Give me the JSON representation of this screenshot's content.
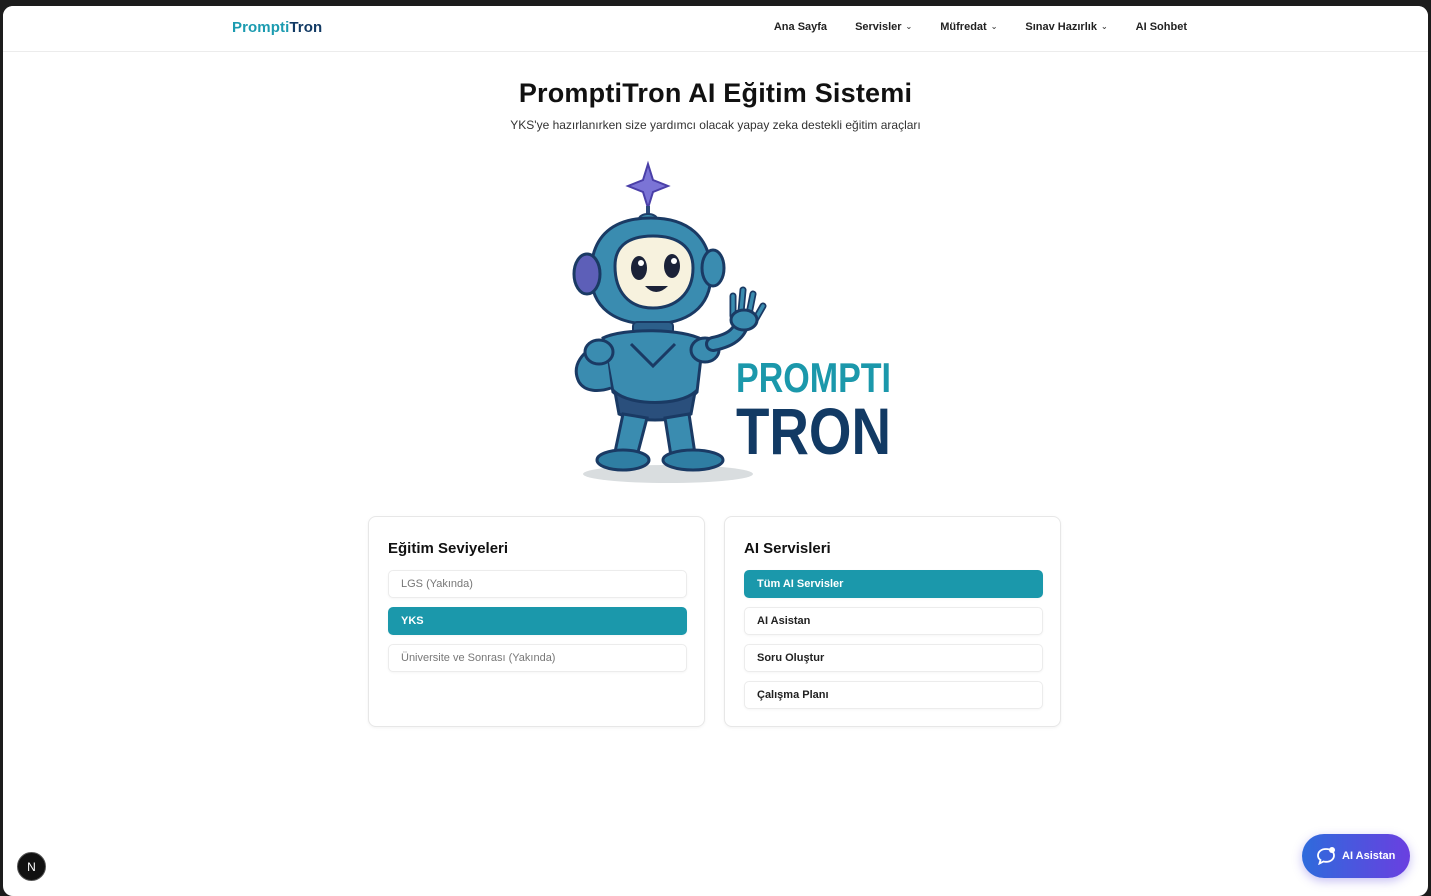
{
  "header": {
    "brand_part1": "Prompti",
    "brand_part2": "Tron",
    "nav": [
      {
        "label": "Ana Sayfa",
        "dropdown": false
      },
      {
        "label": "Servisler",
        "dropdown": true
      },
      {
        "label": "Müfredat",
        "dropdown": true
      },
      {
        "label": "Sınav Hazırlık",
        "dropdown": true
      },
      {
        "label": "AI Sohbet",
        "dropdown": false
      }
    ]
  },
  "hero": {
    "title": "PromptiTron AI Eğitim Sistemi",
    "subtitle": "YKS'ye hazırlanırken size yardımcı olacak yapay zeka destekli eğitim araçları",
    "logo_line1": "PROMPTI",
    "logo_line2": "TRON"
  },
  "levels": {
    "title": "Eğitim Seviyeleri",
    "items": [
      {
        "label": "LGS (Yakında)",
        "state": "disabled"
      },
      {
        "label": "YKS",
        "state": "active"
      },
      {
        "label": "Üniversite ve Sonrası (Yakında)",
        "state": "disabled"
      }
    ]
  },
  "services": {
    "title": "AI Servisleri",
    "items": [
      {
        "label": "Tüm AI Servisler",
        "state": "active"
      },
      {
        "label": "AI Asistan",
        "state": "normal"
      },
      {
        "label": "Soru Oluştur",
        "state": "normal"
      },
      {
        "label": "Çalışma Planı",
        "state": "normal"
      }
    ]
  },
  "floating": {
    "assistant_label": "AI Asistan",
    "dev_badge": "N"
  },
  "colors": {
    "accent": "#1b98ab",
    "brand_dark": "#123a64",
    "assistant_gradient_start": "#2e6bdc",
    "assistant_gradient_end": "#6a3fe0"
  }
}
